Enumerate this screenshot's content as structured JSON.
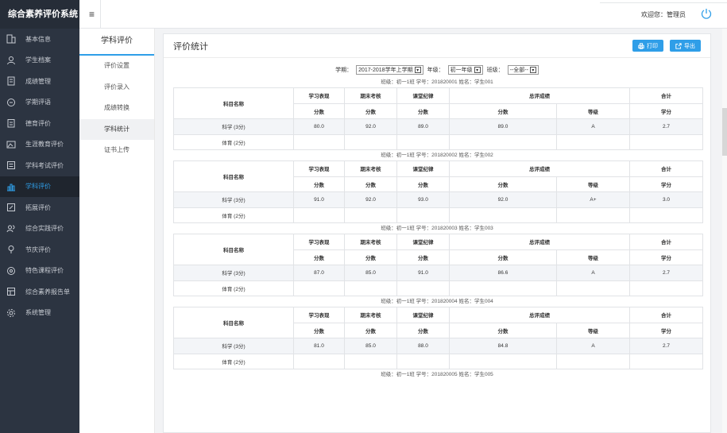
{
  "app": {
    "title": "综合素养评价系统"
  },
  "sidebar": {
    "items": [
      {
        "label": "基本信息",
        "icon": "building-icon"
      },
      {
        "label": "学生档案",
        "icon": "user-icon"
      },
      {
        "label": "成绩管理",
        "icon": "document-icon"
      },
      {
        "label": "学期评语",
        "icon": "chat-icon"
      },
      {
        "label": "德育评价",
        "icon": "clipboard-icon"
      },
      {
        "label": "生涯教育评价",
        "icon": "image-icon"
      },
      {
        "label": "学科考试评价",
        "icon": "list-icon"
      },
      {
        "label": "学科评价",
        "icon": "bar-chart-icon"
      },
      {
        "label": "拓展评价",
        "icon": "edit-icon"
      },
      {
        "label": "综合实践评价",
        "icon": "people-icon"
      },
      {
        "label": "节庆评价",
        "icon": "pin-icon"
      },
      {
        "label": "特色课程评价",
        "icon": "circle-icon"
      },
      {
        "label": "综合素养报告单",
        "icon": "report-icon"
      },
      {
        "label": "系统管理",
        "icon": "gear-icon"
      }
    ]
  },
  "topbar": {
    "menu_icon": "≡",
    "welcome": "欢迎您：管理员"
  },
  "subnav": {
    "title": "学科评价",
    "items": [
      "评价设置",
      "评价录入",
      "成绩转换",
      "学科统计",
      "证书上传"
    ]
  },
  "panel": {
    "title": "评价统计",
    "print_label": "打印",
    "export_label": "导出"
  },
  "filters": {
    "term_label": "学期：",
    "term_value": "2017-2018学年上学期",
    "grade_label": "年级：",
    "grade_value": "初一年级",
    "class_label": "班级：",
    "class_value": "--全部--"
  },
  "table_headers": {
    "subject": "科目名称",
    "study": "学习表现",
    "final": "期末考核",
    "discipline": "课堂纪律",
    "total": "总评成绩",
    "sum": "合计",
    "score": "分数",
    "grade": "等级",
    "credit": "学分"
  },
  "students": [
    {
      "info": "班级：初一1班  学号：201820001  姓名：学生001",
      "science": {
        "subject": "科学 (3分)",
        "study": "80.0",
        "final": "92.0",
        "discipline": "89.0",
        "total": "89.0",
        "grade": "A",
        "credit": "2.7"
      },
      "pe": {
        "subject": "体育 (2分)"
      }
    },
    {
      "info": "班级：初一1班  学号：201820002  姓名：学生002",
      "science": {
        "subject": "科学 (3分)",
        "study": "91.0",
        "final": "92.0",
        "discipline": "93.0",
        "total": "92.0",
        "grade": "A+",
        "credit": "3.0"
      },
      "pe": {
        "subject": "体育 (2分)"
      }
    },
    {
      "info": "班级：初一1班  学号：201820003  姓名：学生003",
      "science": {
        "subject": "科学 (3分)",
        "study": "87.0",
        "final": "85.0",
        "discipline": "91.0",
        "total": "86.6",
        "grade": "A",
        "credit": "2.7"
      },
      "pe": {
        "subject": "体育 (2分)"
      }
    },
    {
      "info": "班级：初一1班  学号：201820004  姓名：学生004",
      "science": {
        "subject": "科学 (3分)",
        "study": "81.0",
        "final": "85.0",
        "discipline": "88.0",
        "total": "84.8",
        "grade": "A",
        "credit": "2.7"
      },
      "pe": {
        "subject": "体育 (2分)"
      }
    },
    {
      "info": "班级：初一1班  学号：201820005  姓名：学生005"
    }
  ],
  "colors": {
    "accent": "#2f9ee8",
    "sidebar_bg": "#2c3441"
  }
}
